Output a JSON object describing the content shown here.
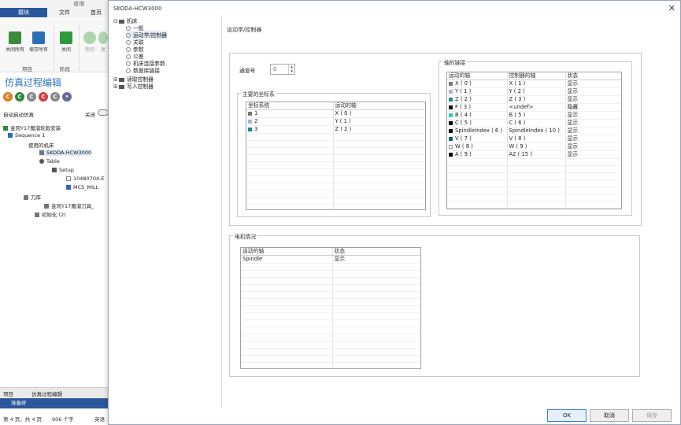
{
  "bg": {
    "ribbon_top": "咨询",
    "tab_active": "模块",
    "tab_file": "文件",
    "tab_home": "首页",
    "btn_close_all": "关闭所有",
    "btn_save_all": "保存所有",
    "btn_close": "关闭",
    "btn_cut": "剪切",
    "btn_more": "复",
    "group_project": "项目",
    "group_stage": "阶段",
    "title": "仿真过程编辑",
    "autosim": "自动启动仿真",
    "close_label": "关闭",
    "tree": [
      "金冈Y17魔溜轮毂安装",
      "Sequence 1",
      "使用的机床",
      "SKODA-HCW3000",
      "Table",
      "Setup",
      "10480704-E",
      "MCS_MILL",
      "刀库",
      "金冈Y17魔溜刀具_",
      "初始化 (2)"
    ],
    "tab_project": "项目",
    "tab_sim_edit": "仿真过程编辑",
    "status_ready": "准备好",
    "status_page": "第 4 页，共 4 页",
    "status_words": "906 个字",
    "status_lang": "英语"
  },
  "dialog": {
    "title": "SKODA-HCW3000",
    "content_title": "运动学/控制器",
    "nav": {
      "machine": "机床",
      "general": "一般",
      "kinematics": "运动学/控制器",
      "joints": "关联",
      "params": "参数",
      "tolerance": "公差",
      "machine_params": "机床连接参数",
      "db_link": "数据库链接",
      "read_ctrl": "读取控制器",
      "write_ctrl": "写入控制器"
    },
    "channel_label": "通道号",
    "channel_value": "0",
    "main_cs": {
      "label": "主要的坐标系",
      "headers": [
        "坐标系统",
        "运动的轴"
      ],
      "rows": [
        {
          "c1": "1",
          "c2": "X ( 0 )",
          "color": "#777777"
        },
        {
          "c1": "2",
          "c2": "Y ( 1 )",
          "color": "#a9b4d8"
        },
        {
          "c1": "3",
          "c2": "Z ( 2 )",
          "color": "#1f8a8a"
        }
      ]
    },
    "axis_link": {
      "label": "轴的链接",
      "headers": [
        "运动的轴",
        "控制器的轴",
        "状态"
      ],
      "rows": [
        {
          "c1": "X ( 0 )",
          "c2": "X ( 1 )",
          "c3": "显示",
          "color": "#777777"
        },
        {
          "c1": "Y ( 1 )",
          "c2": "Y ( 2 )",
          "c3": "显示",
          "color": "#a9b4d8"
        },
        {
          "c1": "Z ( 2 )",
          "c2": "Z ( 3 )",
          "c3": "显示",
          "color": "#1f8a8a"
        },
        {
          "c1": "F ( 3 )",
          "c2": "<undef>",
          "c3": "隐藏",
          "color": "#000000"
        },
        {
          "c1": "B ( 4 )",
          "c2": "B ( 5 )",
          "c3": "显示",
          "color": "#2ad0d0"
        },
        {
          "c1": "C ( 5 )",
          "c2": "C ( 6 )",
          "c3": "显示",
          "color": "#000000"
        },
        {
          "c1": "SpindleIndex ( 6 )",
          "c2": "SpindleIndex ( 10 )",
          "c3": "显示",
          "color": "#000000"
        },
        {
          "c1": "V ( 7 )",
          "c2": "V ( 8 )",
          "c3": "显示",
          "color": "#1a6060"
        },
        {
          "c1": "W ( 8 )",
          "c2": "W ( 9 )",
          "c3": "显示",
          "color": "#ffffff"
        },
        {
          "c1": "A ( 9 )",
          "c2": "A2 ( 15 )",
          "c3": "显示",
          "color": "#000000"
        }
      ]
    },
    "motor": {
      "label": "电机情况",
      "headers": [
        "运动的轴",
        "状态"
      ],
      "rows": [
        {
          "c1": "Spindle",
          "c2": "显示"
        }
      ]
    },
    "buttons": {
      "ok": "OK",
      "cancel": "取消",
      "save": "保存"
    }
  }
}
